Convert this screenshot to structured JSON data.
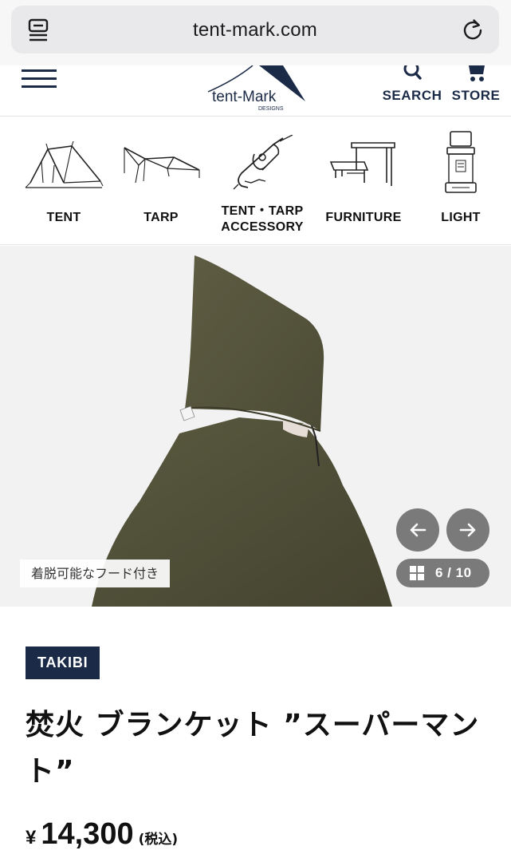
{
  "browser": {
    "url": "tent-mark.com",
    "reader_icon": "reader-mode-icon",
    "reload_icon": "reload-icon"
  },
  "header": {
    "logo_text": "tent-Mark",
    "logo_subtext": "DESIGNS",
    "search_label": "SEARCH",
    "store_label": "STORE",
    "accent": "#1b2a47"
  },
  "categories": [
    {
      "label": "TENT",
      "icon": "tent-icon"
    },
    {
      "label": "TARP",
      "icon": "tarp-icon"
    },
    {
      "label_line1": "TENT・TARP",
      "label_line2": "ACCESSORY",
      "icon": "carabiner-icon"
    },
    {
      "label": "FURNITURE",
      "icon": "table-icon"
    },
    {
      "label": "LIGHT",
      "icon": "lantern-icon"
    }
  ],
  "gallery": {
    "caption": "着脱可能なフード付き",
    "counter": "6 / 10",
    "prev_icon": "arrow-left-icon",
    "next_icon": "arrow-right-icon",
    "grid_icon": "grid-icon"
  },
  "product": {
    "brand_badge": "TAKIBI",
    "title": "焚火 ブランケット ”スーパーマント”",
    "price_currency": "¥",
    "price_amount": "14,300",
    "price_tax": "(税込)"
  }
}
